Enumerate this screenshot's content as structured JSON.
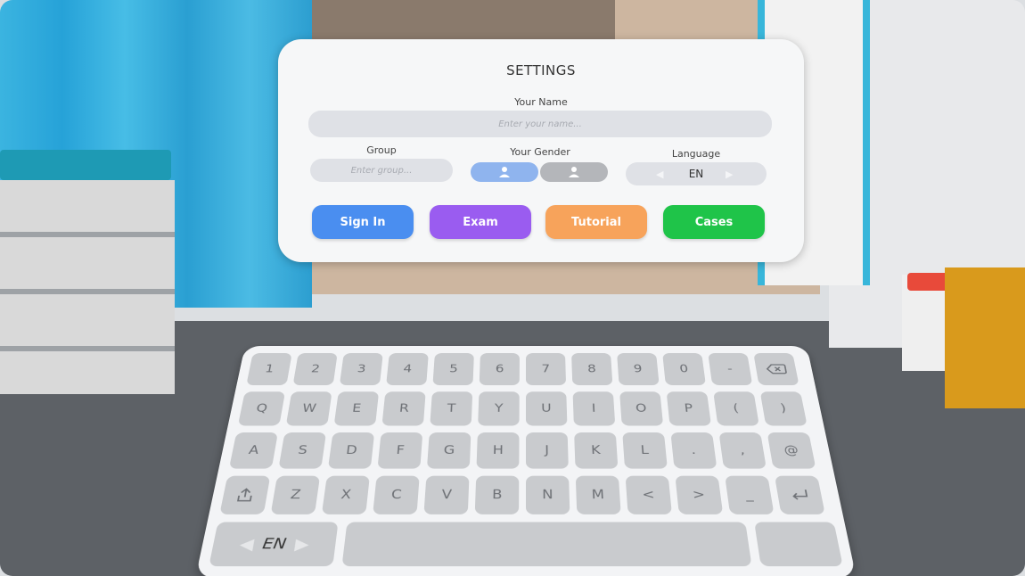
{
  "settings": {
    "title": "SETTINGS",
    "name_label": "Your Name",
    "name_placeholder": "Enter your name...",
    "group_label": "Group",
    "group_placeholder": "Enter group...",
    "gender_label": "Your Gender",
    "gender_options": [
      "male",
      "female"
    ],
    "gender_selected": "male",
    "language_label": "Language",
    "language_value": "EN"
  },
  "buttons": {
    "sign_in": "Sign In",
    "exam": "Exam",
    "tutorial": "Tutorial",
    "cases": "Cases"
  },
  "keyboard": {
    "rows": [
      [
        "1",
        "2",
        "3",
        "4",
        "5",
        "6",
        "7",
        "8",
        "9",
        "0",
        "-",
        "backspace-icon"
      ],
      [
        "Q",
        "W",
        "E",
        "R",
        "T",
        "Y",
        "U",
        "I",
        "O",
        "P",
        "(",
        ")"
      ],
      [
        "A",
        "S",
        "D",
        "F",
        "G",
        "H",
        "J",
        "K",
        "L",
        ".",
        ",",
        "@"
      ],
      [
        "shift-icon",
        "Z",
        "X",
        "C",
        "V",
        "B",
        "N",
        "M",
        "<",
        ">",
        "_",
        "enter-icon"
      ]
    ],
    "language": "EN",
    "space_label": ""
  },
  "colors": {
    "sign_in": "#4a8ef0",
    "exam": "#9a5cf0",
    "tutorial": "#f7a35b",
    "cases": "#1fc449",
    "gender_selected": "#8fb4ee",
    "gender_unselected": "#b4b6ba"
  }
}
